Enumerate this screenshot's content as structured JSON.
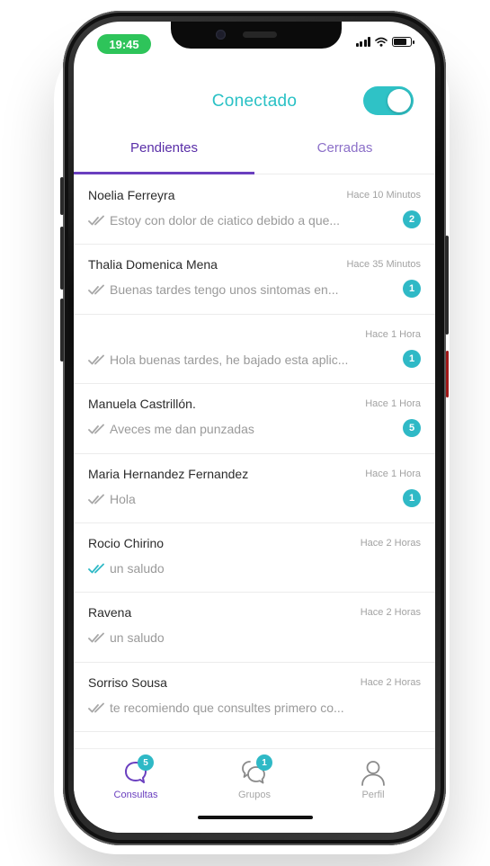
{
  "status_bar": {
    "time": "19:45"
  },
  "header": {
    "title": "Conectado",
    "toggle_on": true
  },
  "tabs": [
    {
      "label": "Pendientes",
      "active": true
    },
    {
      "label": "Cerradas",
      "active": false
    }
  ],
  "conversations": [
    {
      "name": "Noelia Ferreyra",
      "time": "Hace 10 Minutos",
      "preview": "Estoy con dolor de ciatico debido a que...",
      "badge": "2",
      "read": false
    },
    {
      "name": "Thalia Domenica Mena",
      "time": "Hace 35 Minutos",
      "preview": "Buenas tardes tengo unos sintomas en...",
      "badge": "1",
      "read": false
    },
    {
      "name": "",
      "time": "Hace 1 Hora",
      "preview": "Hola buenas tardes, he bajado esta aplic...",
      "badge": "1",
      "read": false
    },
    {
      "name": "Manuela Castrillón.",
      "time": "Hace 1 Hora",
      "preview": "Aveces me dan punzadas",
      "badge": "5",
      "read": false
    },
    {
      "name": "Maria Hernandez Fernandez",
      "time": "Hace 1 Hora",
      "preview": "Hola",
      "badge": "1",
      "read": false
    },
    {
      "name": "Rocio Chirino",
      "time": "Hace 2 Horas",
      "preview": "un saludo",
      "badge": "",
      "read": true
    },
    {
      "name": "Ravena",
      "time": "Hace 2 Horas",
      "preview": "un saludo",
      "badge": "",
      "read": false
    },
    {
      "name": "Sorriso Sousa",
      "time": "Hace 2 Horas",
      "preview": "te recomiendo que consultes primero co...",
      "badge": "",
      "read": false
    }
  ],
  "bottom_nav": [
    {
      "label": "Consultas",
      "icon": "chat-bubble-icon",
      "badge": "5",
      "active": true
    },
    {
      "label": "Grupos",
      "icon": "group-chat-icon",
      "badge": "1",
      "active": false
    },
    {
      "label": "Perfil",
      "icon": "user-icon",
      "badge": "",
      "active": false
    }
  ],
  "colors": {
    "accent_teal": "#2fc2c6",
    "accent_purple": "#6a3fbf",
    "badge": "#2fb9c6",
    "check_read": "#2fb9c6",
    "check_unread": "#a8a8a8"
  }
}
